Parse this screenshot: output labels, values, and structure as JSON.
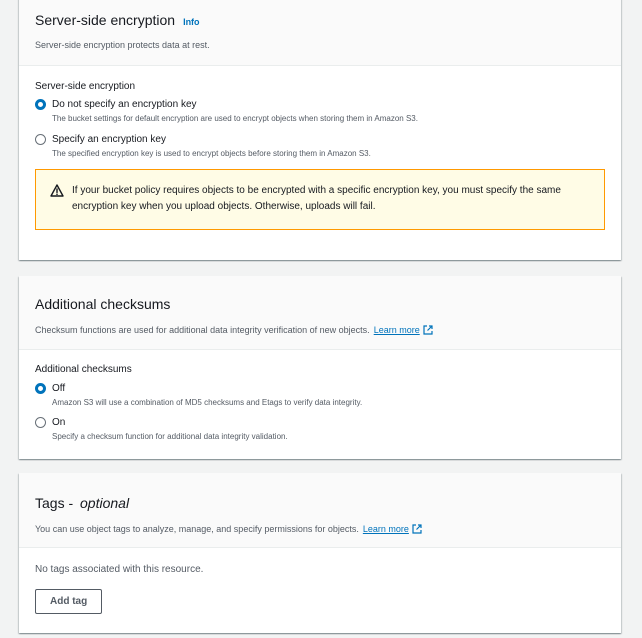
{
  "encryption": {
    "title": "Server-side encryption",
    "info": "Info",
    "description": "Server-side encryption protects data at rest.",
    "field_label": "Server-side encryption",
    "options": [
      {
        "label": "Do not specify an encryption key",
        "description": "The bucket settings for default encryption are used to encrypt objects when storing them in Amazon S3.",
        "checked": true
      },
      {
        "label": "Specify an encryption key",
        "description": "The specified encryption key is used to encrypt objects before storing them in Amazon S3.",
        "checked": false
      }
    ],
    "alert": "If your bucket policy requires objects to be encrypted with a specific encryption key, you must specify the same encryption key when you upload objects. Otherwise, uploads will fail."
  },
  "checksums": {
    "title": "Additional checksums",
    "description": "Checksum functions are used for additional data integrity verification of new objects.",
    "learn_more": "Learn more",
    "field_label": "Additional checksums",
    "options": [
      {
        "label": "Off",
        "description": "Amazon S3 will use a combination of MD5 checksums and Etags to verify data integrity.",
        "checked": true
      },
      {
        "label": "On",
        "description": "Specify a checksum function for additional data integrity validation.",
        "checked": false
      }
    ]
  },
  "tags": {
    "title": "Tags - ",
    "title_optional": "optional",
    "description": "You can use object tags to analyze, manage, and specify permissions for objects.",
    "learn_more": "Learn more",
    "empty": "No tags associated with this resource.",
    "add_button": "Add tag"
  },
  "colors": {
    "accent": "#0073bb",
    "warning_border": "#ff9900",
    "warning_bg": "#fffce6"
  }
}
